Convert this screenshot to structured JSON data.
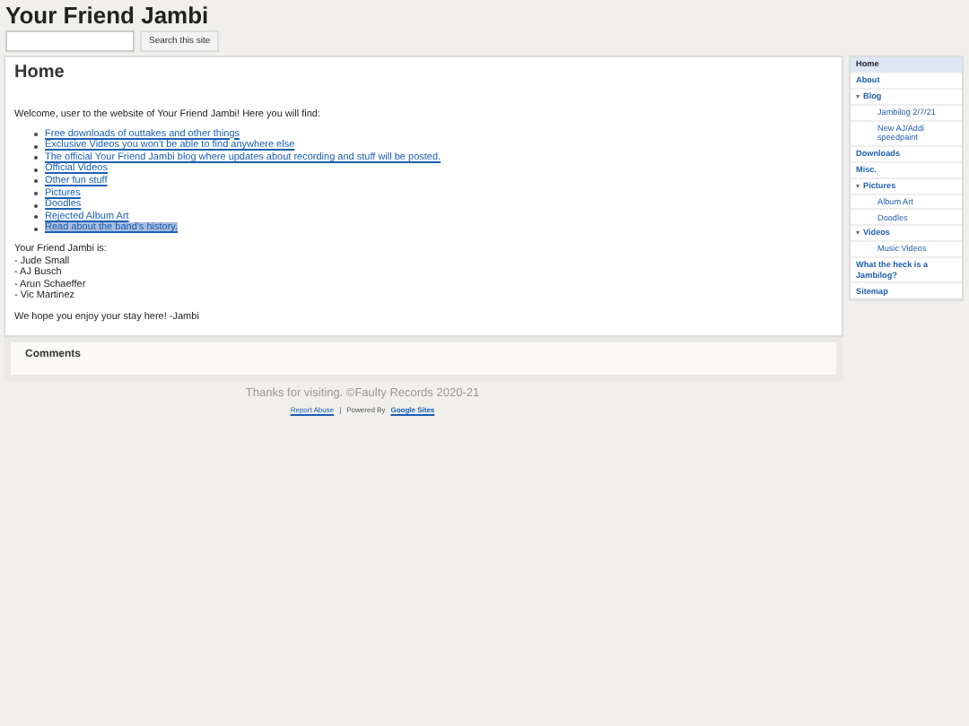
{
  "site_title": "Your Friend Jambi",
  "search": {
    "button": "Search this site"
  },
  "page": {
    "title": "Home",
    "intro": "Welcome, user to the website of Your Friend Jambi! Here you will find:",
    "links": [
      {
        "label": "Free downloads of outtakes and other things",
        "highlighted": false
      },
      {
        "label": "Exclusive Videos you won't be able to find anywhere else",
        "highlighted": false
      },
      {
        "label": "The official Your Friend Jambi blog where updates about recording and stuff will be posted.",
        "highlighted": false
      },
      {
        "label": "Official Videos",
        "highlighted": false
      },
      {
        "label": "Other fun stuff",
        "highlighted": false
      },
      {
        "label": "Pictures",
        "highlighted": false
      },
      {
        "label": "Doodles",
        "highlighted": false
      },
      {
        "label": "Rejected Album Art",
        "highlighted": false
      },
      {
        "label": "Read about the band's history.",
        "highlighted": true
      }
    ],
    "members_heading": "Your Friend Jambi is:",
    "members": [
      "- Jude Small",
      "- AJ Busch",
      "- Arun Schaeffer",
      "- Vic Martinez"
    ],
    "closing": "We hope you enjoy your stay here! -Jambi"
  },
  "comments": {
    "title": "Comments"
  },
  "sidebar": {
    "items": [
      {
        "label": "Home",
        "selected": true
      },
      {
        "label": "About",
        "selected": false
      },
      {
        "label": "Blog",
        "selected": false,
        "expanded": true,
        "children": [
          {
            "label": "Jambilog 2/7/21",
            "selected": false
          },
          {
            "label": "New AJ/Addi speedpaint",
            "selected": false
          }
        ]
      },
      {
        "label": "Downloads",
        "selected": false
      },
      {
        "label": "Misc.",
        "selected": false
      },
      {
        "label": "Pictures",
        "selected": false,
        "expanded": true,
        "children": [
          {
            "label": "Album Art",
            "selected": false
          },
          {
            "label": "Doodles",
            "selected": false
          }
        ]
      },
      {
        "label": "Videos",
        "selected": false,
        "expanded": true,
        "children": [
          {
            "label": "Music Videos",
            "selected": false
          }
        ]
      },
      {
        "label": "What the heck is a Jambilog?",
        "selected": false
      },
      {
        "label": "Sitemap",
        "selected": false
      }
    ]
  },
  "footer": {
    "message": "Thanks for visiting. ©Faulty Records 2020-21",
    "links": [
      "Report Abuse",
      "|",
      "Powered By",
      "Google Sites"
    ]
  }
}
